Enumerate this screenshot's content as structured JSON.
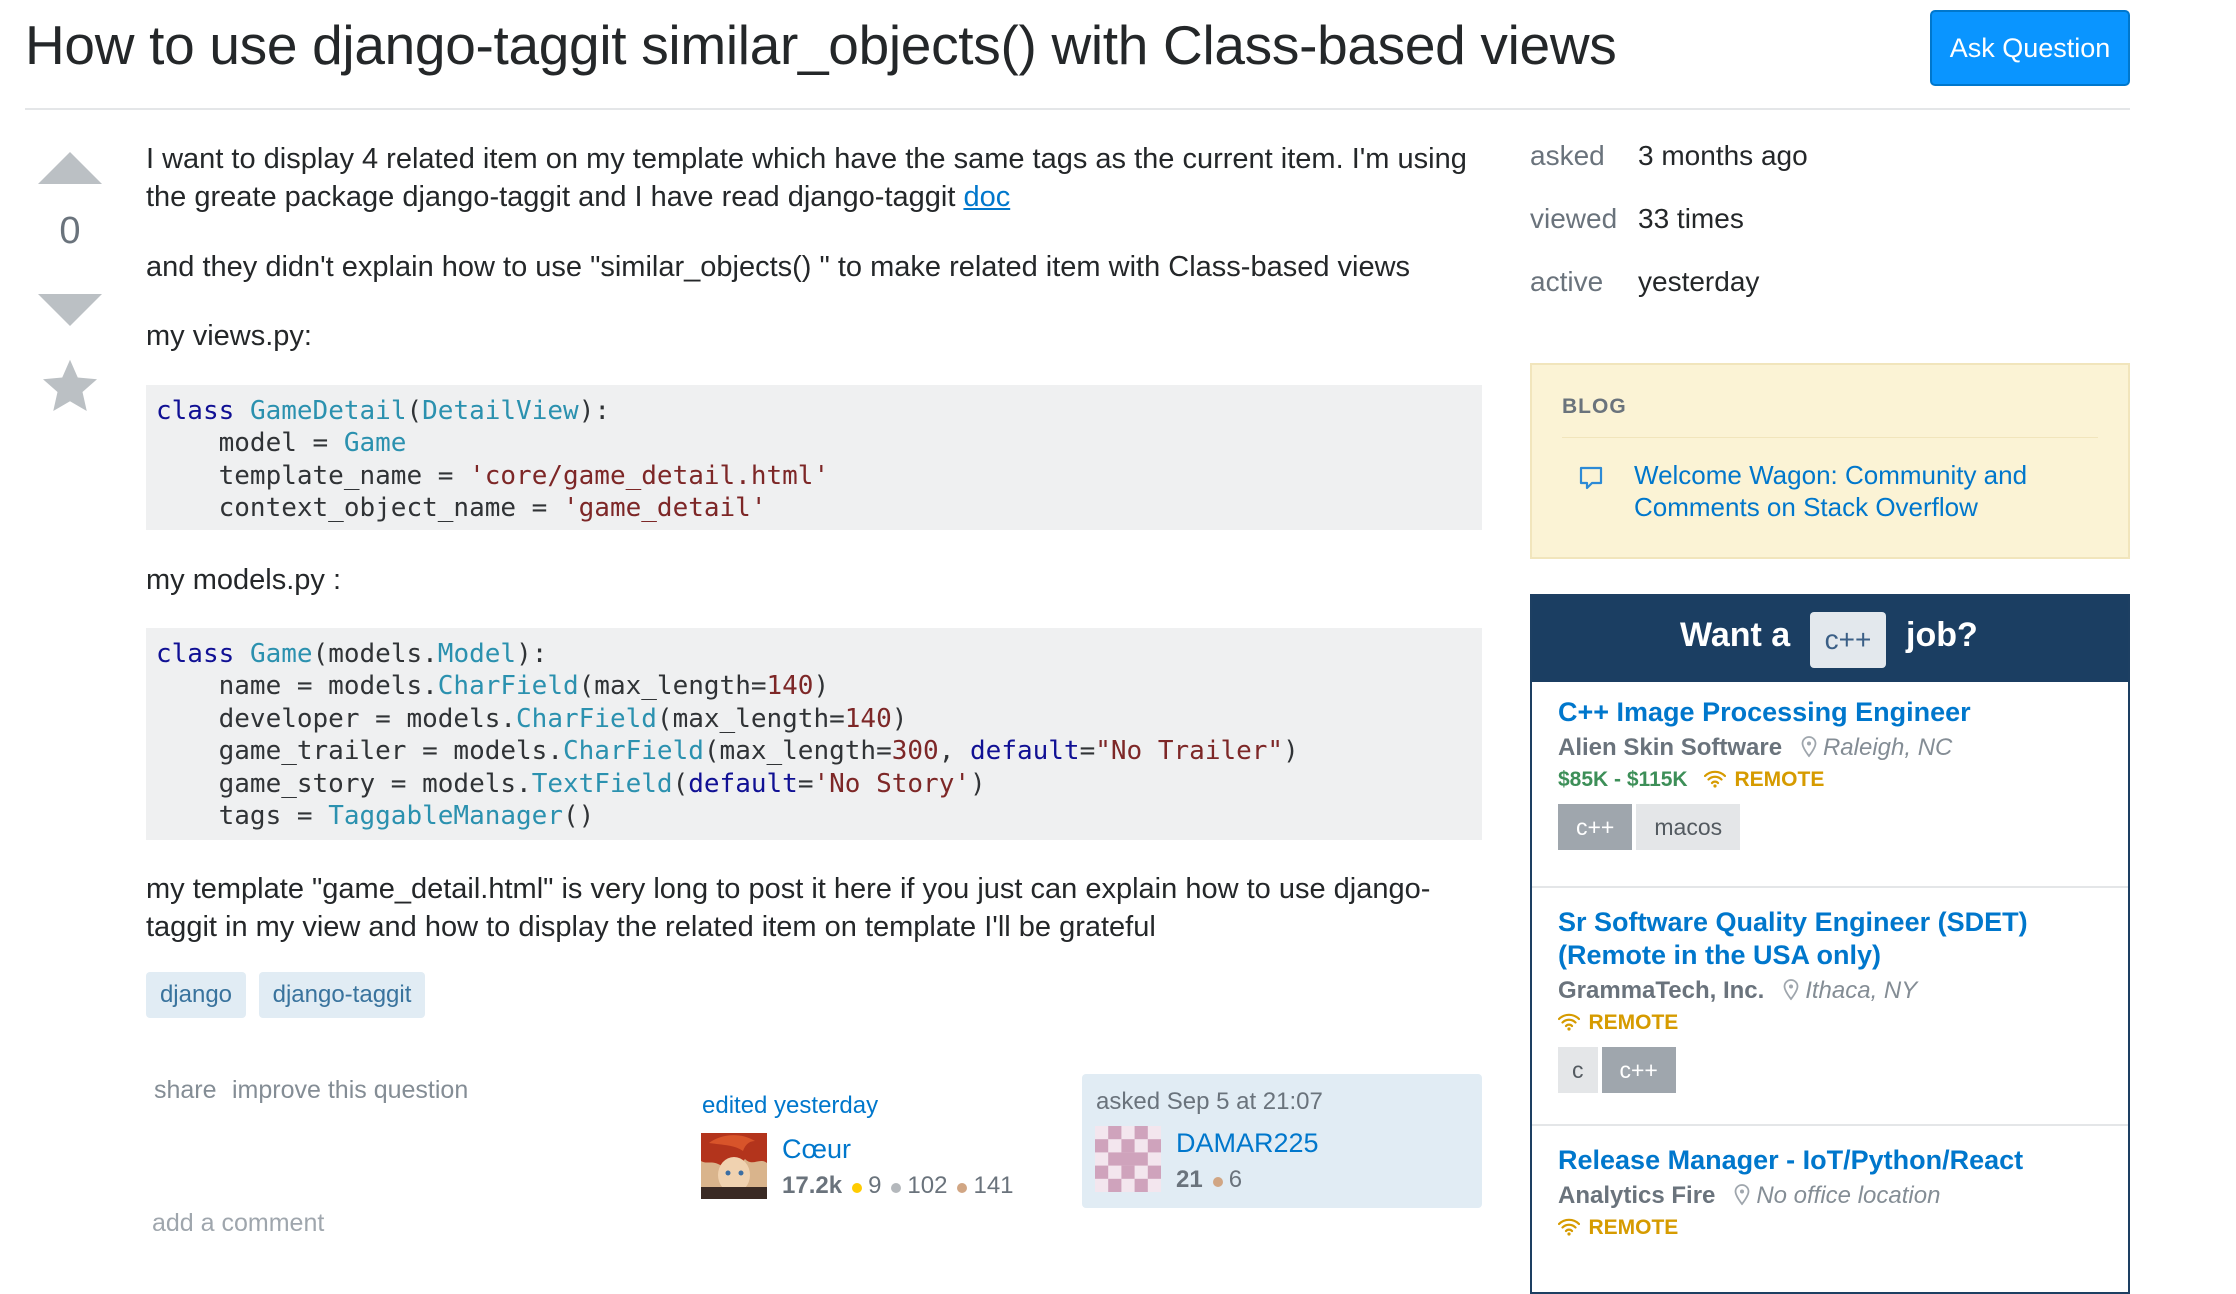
{
  "question": {
    "title": "How to use django-taggit similar_objects() with Class-based views",
    "ask_button": "Ask Question",
    "vote_count": "0",
    "body": {
      "p1_a": "I want to display 4 related item on my template which have the same tags as the current item. I'm using the greate package django-taggit and I have read django-taggit ",
      "p1_link": "doc",
      "p2": "and they didn't explain how to use \"similar_objects() \" to make related item with Class-based views",
      "p3": "my views.py:",
      "code1": {
        "l1_kw": "class",
        "l1_name": "GameDetail",
        "l1_p1": "(",
        "l1_base": "DetailView",
        "l1_p2": "):",
        "l2_a": "    model = ",
        "l2_b": "Game",
        "l3_a": "    template_name = ",
        "l3_b": "'core/game_detail.html'",
        "l4_a": "    context_object_name = ",
        "l4_b": "'game_detail'"
      },
      "p4": "my models.py :",
      "code2": {
        "l1_kw": "class",
        "l1_name": "Game",
        "l1_p1": "(models.",
        "l1_base": "Model",
        "l1_p2": "):",
        "l2_a": "    name = models.",
        "l2_b": "CharField",
        "l2_c": "(max_length=",
        "l2_d": "140",
        "l2_e": ")",
        "l3_a": "    developer = models.",
        "l3_b": "CharField",
        "l3_c": "(max_length=",
        "l3_d": "140",
        "l3_e": ")",
        "l4_a": "    game_trailer = models.",
        "l4_b": "CharField",
        "l4_c": "(max_length=",
        "l4_d": "300",
        "l4_e": ", ",
        "l4_f": "default",
        "l4_g": "=",
        "l4_h": "\"No Trailer\"",
        "l4_i": ")",
        "l5_a": "    game_story = models.",
        "l5_b": "TextField",
        "l5_c": "(",
        "l5_d": "default",
        "l5_e": "=",
        "l5_f": "'No Story'",
        "l5_g": ")",
        "l6_a": "    tags = ",
        "l6_b": "TaggableManager",
        "l6_c": "()"
      },
      "p5": "my template \"game_detail.html\" is very long to post it here if you just can explain how to use django-taggit in my view and how to display the related item on template I'll be grateful"
    },
    "tags": [
      "django",
      "django-taggit"
    ],
    "menu": {
      "share": "share",
      "improve": "improve this question"
    },
    "edited": {
      "action": "edited yesterday",
      "user": "Cœur",
      "rep": "17.2k",
      "gold": "9",
      "silver": "102",
      "bronze": "141"
    },
    "asked": {
      "action": "asked Sep 5 at 21:07",
      "user": "DAMAR225",
      "rep": "21",
      "bronze": "6"
    },
    "add_comment": "add a comment"
  },
  "stats": [
    {
      "label": "asked",
      "value": "3 months ago"
    },
    {
      "label": "viewed",
      "value": "33 times"
    },
    {
      "label": "active",
      "value": "yesterday"
    }
  ],
  "blog": {
    "header": "BLOG",
    "link": "Welcome Wagon: Community and Comments on Stack Overflow"
  },
  "jobs": {
    "want": "Want a",
    "pill": "c++",
    "job": "job?",
    "items": [
      {
        "title": "C++ Image Processing Engineer",
        "company": "Alien Skin Software",
        "location": "Raleigh, NC",
        "salary": "$85K - $115K",
        "remote": "REMOTE",
        "tags": [
          "c++",
          "macos"
        ]
      },
      {
        "title": "Sr Software Quality Engineer (SDET) (Remote in the USA only)",
        "company": "GrammaTech, Inc.",
        "location": "Ithaca, NY",
        "remote": "REMOTE",
        "tags": [
          "c",
          "c++"
        ]
      },
      {
        "title": "Release Manager - IoT/Python/React",
        "company": "Analytics Fire",
        "location": "No office location",
        "remote": "REMOTE"
      }
    ]
  },
  "colors": {
    "accent": "#0a95ff",
    "link": "#0077cc",
    "tag_bg": "#e1ecf4",
    "blog_bg": "#fbf3d5",
    "jobs_banner": "#1b3e62"
  },
  "icons": [
    "vote-up-icon",
    "vote-down-icon",
    "star-icon",
    "speech-bubble-icon",
    "location-pin-icon",
    "wifi-icon",
    "avatar"
  ]
}
